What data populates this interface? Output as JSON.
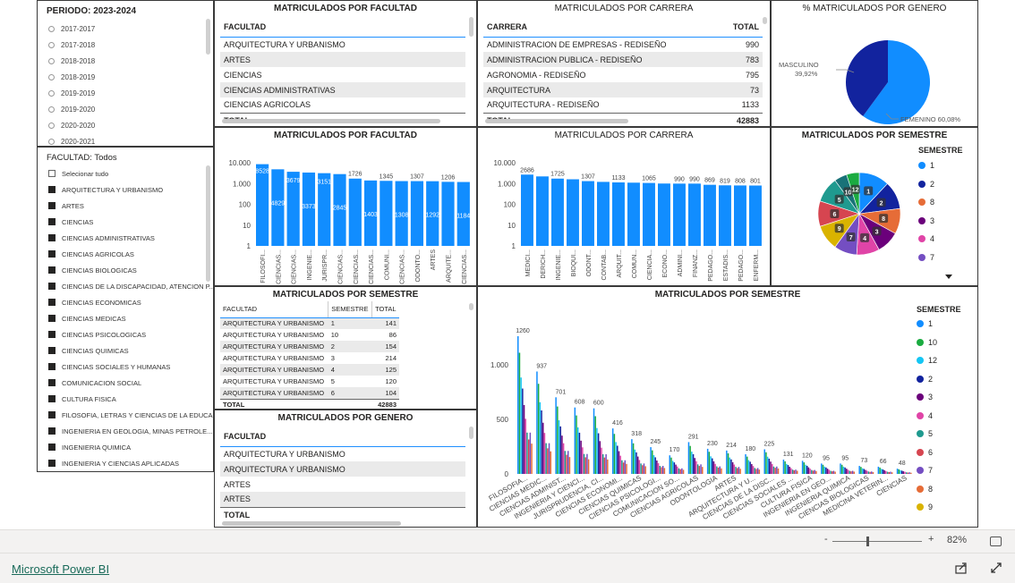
{
  "colors": {
    "blue": "#118DFF",
    "navy": "#12239E",
    "orange": "#E66C37",
    "purple": "#6B007B",
    "pink": "#E044A7",
    "violet": "#744EC2",
    "yellow": "#D9B300",
    "red": "#D64550",
    "teal": "#197278",
    "green": "#1AAB40",
    "cyan": "#15C6F4",
    "darkteal": "#1F9A8F"
  },
  "periodo": {
    "title": "PERIODO: 2023-2024",
    "options": [
      "2017-2017",
      "2017-2018",
      "2018-2018",
      "2018-2019",
      "2019-2019",
      "2019-2020",
      "2020-2020",
      "2020-2021"
    ]
  },
  "facultad_slicer": {
    "title": "FACULTAD: Todos",
    "select_all": "Selecionar tudo",
    "items": [
      "ARQUITECTURA Y URBANISMO",
      "ARTES",
      "CIENCIAS",
      "CIENCIAS ADMINISTRATIVAS",
      "CIENCIAS AGRICOLAS",
      "CIENCIAS BIOLOGICAS",
      "CIENCIAS DE LA DISCAPACIDAD, ATENCION P...",
      "CIENCIAS ECONOMICAS",
      "CIENCIAS MEDICAS",
      "CIENCIAS PSICOLOGICAS",
      "CIENCIAS QUIMICAS",
      "CIENCIAS SOCIALES Y HUMANAS",
      "COMUNICACION SOCIAL",
      "CULTURA FISICA",
      "FILOSOFIA, LETRAS Y CIENCIAS DE LA EDUCA...",
      "INGENIERIA EN GEOLOGIA, MINAS PETROLE...",
      "INGENIERIA QUIMICA",
      "INGENIERIA Y CIENCIAS APLICADAS"
    ]
  },
  "tbl_facultad": {
    "title": "MATRICULADOS POR FACULTAD",
    "col": "FACULTAD",
    "rows": [
      "ARQUITECTURA Y URBANISMO",
      "ARTES",
      "CIENCIAS",
      "CIENCIAS ADMINISTRATIVAS",
      "CIENCIAS AGRICOLAS"
    ],
    "total_label": "TOTAL"
  },
  "tbl_carrera": {
    "title": "MATRICULADOS POR CARRERA",
    "col1": "CARRERA",
    "col2": "TOTAL",
    "rows": [
      [
        "ADMINISTRACION DE EMPRESAS - REDISEÑO",
        "990"
      ],
      [
        "ADMINISTRACION PUBLICA - REDISEÑO",
        "783"
      ],
      [
        "AGRONOMIA - REDISEÑO",
        "795"
      ],
      [
        "ARQUITECTURA",
        "73"
      ],
      [
        "ARQUITECTURA - REDISEÑO",
        "1133"
      ]
    ],
    "total_label": "TOTAL",
    "total": "42883"
  },
  "pie_genero": {
    "title": "% MATRICULADOS POR GENERO",
    "masculino_label": "MASCULINO",
    "masculino_pct": "39,92%",
    "femenino_label": "FEMENINO 60,08%",
    "masculino_value": 39.92,
    "femenino_value": 60.08
  },
  "bar_facultad": {
    "title": "MATRICULADOS POR FACULTAD",
    "yticks": [
      "10.000",
      "1.000",
      "100",
      "10",
      "1"
    ],
    "categories": [
      "FILOSOFI...",
      "CIENCIAS...",
      "CIENCIAS...",
      "INGENIE...",
      "JURISPR...",
      "CIENCIAS...",
      "CIENCIAS...",
      "CIENCIAS...",
      "COMUNI...",
      "CIENCIAS...",
      "ODONTO...",
      "ARTES",
      "ARQUITE...",
      "CIENCIAS..."
    ],
    "values": [
      8528,
      4829,
      3679,
      3373,
      3151,
      2845,
      1726,
      1403,
      1345,
      1308,
      1307,
      1292,
      1206,
      1184
    ],
    "labels": [
      "8528",
      "4829",
      "3679",
      "3373",
      "3151",
      "2845",
      "1726",
      "1403",
      "1345",
      "1308",
      "1307",
      "1292",
      "1206",
      "1184"
    ]
  },
  "bar_carrera": {
    "title": "MATRICULADOS POR CARRERA",
    "yticks": [
      "10.000",
      "1.000",
      "100",
      "10",
      "1"
    ],
    "categories": [
      "MEDICI...",
      "DERICH...",
      "INGENIE...",
      "BIOQUI...",
      "ODONT...",
      "CONTAB...",
      "ARQUIT...",
      "COMUN...",
      "CIENCIA...",
      "ECONO...",
      "ADMINI...",
      "FINANZ...",
      "PEDAGO...",
      "ESTADIS...",
      "PEDAGO...",
      "ENFERM..."
    ],
    "values": [
      2686,
      2200,
      1725,
      1600,
      1307,
      1200,
      1133,
      1100,
      1065,
      1000,
      990,
      990,
      869,
      819,
      808,
      801
    ],
    "labels": [
      "2686",
      "",
      "1725",
      "",
      "1307",
      "",
      "1133",
      "",
      "1065",
      "",
      "990",
      "990",
      "869",
      "819",
      "808",
      "801"
    ]
  },
  "pie_semestre": {
    "title": "MATRICULADOS POR SEMESTRE",
    "legend_title": "SEMESTRE",
    "legend": [
      "1",
      "2",
      "8",
      "3",
      "4",
      "7"
    ],
    "slices": [
      {
        "label": "1",
        "v": 12
      },
      {
        "label": "2",
        "v": 11
      },
      {
        "label": "8",
        "v": 10
      },
      {
        "label": "3",
        "v": 9
      },
      {
        "label": "4",
        "v": 9
      },
      {
        "label": "7",
        "v": 9
      },
      {
        "label": "9",
        "v": 10
      },
      {
        "label": "6",
        "v": 10
      },
      {
        "label": "5",
        "v": 10
      },
      {
        "label": "10",
        "v": 5
      },
      {
        "label": "12",
        "v": 5
      }
    ]
  },
  "tbl_semestre": {
    "title": "MATRICULADOS POR SEMESTRE",
    "cols": [
      "FACULTAD",
      "SEMESTRE",
      "TOTAL"
    ],
    "rows": [
      [
        "ARQUITECTURA Y URBANISMO",
        "1",
        "141"
      ],
      [
        "ARQUITECTURA Y URBANISMO",
        "10",
        "86"
      ],
      [
        "ARQUITECTURA Y URBANISMO",
        "2",
        "154"
      ],
      [
        "ARQUITECTURA Y URBANISMO",
        "3",
        "214"
      ],
      [
        "ARQUITECTURA Y URBANISMO",
        "4",
        "125"
      ],
      [
        "ARQUITECTURA Y URBANISMO",
        "5",
        "120"
      ],
      [
        "ARQUITECTURA Y URBANISMO",
        "6",
        "104"
      ]
    ],
    "total_label": "TOTAL",
    "total": "42883"
  },
  "tbl_genero": {
    "title": "MATRICULADOS POR GENERO",
    "col": "FACULTAD",
    "rows": [
      "ARQUITECTURA Y URBANISMO",
      "ARQUITECTURA Y URBANISMO",
      "ARTES",
      "ARTES"
    ],
    "total_label": "TOTAL"
  },
  "col_semestre": {
    "title": "MATRICULADOS POR SEMESTRE",
    "legend_title": "SEMESTRE",
    "legend": [
      "1",
      "10",
      "12",
      "2",
      "3",
      "4",
      "5",
      "6",
      "7",
      "8",
      "9"
    ],
    "yticks": [
      "1.000",
      "500",
      "0"
    ],
    "categories": [
      "FILOSOFIA...",
      "CIENCIAS MEDIC...",
      "CIENCIAS ADMINIST...",
      "INGENIERIA Y CIENCI...",
      "JURISPRUDENCIA, CI...",
      "CIENCIAS ECONOMI...",
      "CIENCIAS QUIMICAS",
      "CIENCIAS PSICOLOGI...",
      "COMUNICACION SO...",
      "CIENCIAS AGRICOLAS",
      "ODONTOLOGIA",
      "ARTES",
      "ARQUITECTURA Y U...",
      "CIENCIAS DE LA DISC...",
      "CIENCIAS SOCIALES ...",
      "CULTURA FISICA",
      "INGENIERIA EN GEO...",
      "INGENIERIA QUIMICA",
      "CIENCIAS BIOLOGICAS",
      "MEDICINA VETERIN...",
      "CIENCIAS"
    ],
    "peaks": [
      1260,
      937,
      701,
      608,
      600,
      416,
      318,
      245,
      170,
      291,
      230,
      214,
      180,
      225,
      131,
      120,
      95,
      95,
      73,
      66,
      48
    ],
    "peak_labels": [
      "1260",
      "937",
      "701",
      "608",
      "600",
      "416",
      "318",
      "245",
      "170",
      "291",
      "230",
      "214",
      "180",
      "225",
      "131",
      "120",
      "95",
      "95",
      "73",
      "66",
      "48"
    ]
  },
  "footer": {
    "zoom": "82%",
    "minus": "-",
    "plus": "+",
    "brand": "Microsoft Power BI"
  }
}
